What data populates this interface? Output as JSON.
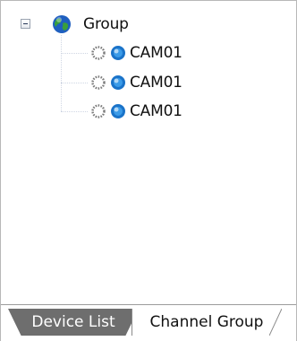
{
  "tree": {
    "root": {
      "label": "Group",
      "icon": "globe-icon",
      "expanded": true
    },
    "children": [
      {
        "label": "CAM01",
        "status_icon": "loading-ring-icon",
        "icon": "camera-dot-icon"
      },
      {
        "label": "CAM01",
        "status_icon": "loading-ring-icon",
        "icon": "camera-dot-icon"
      },
      {
        "label": "CAM01",
        "status_icon": "loading-ring-icon",
        "icon": "camera-dot-icon"
      }
    ]
  },
  "tabs": [
    {
      "label": "Device List",
      "active": false
    },
    {
      "label": "Channel Group",
      "active": true
    }
  ],
  "colors": {
    "camera_blue": "#1a73c9",
    "globe_green": "#3aa03a",
    "globe_blue": "#1f5fbf",
    "inactive_tab": "#6e6e6e"
  }
}
